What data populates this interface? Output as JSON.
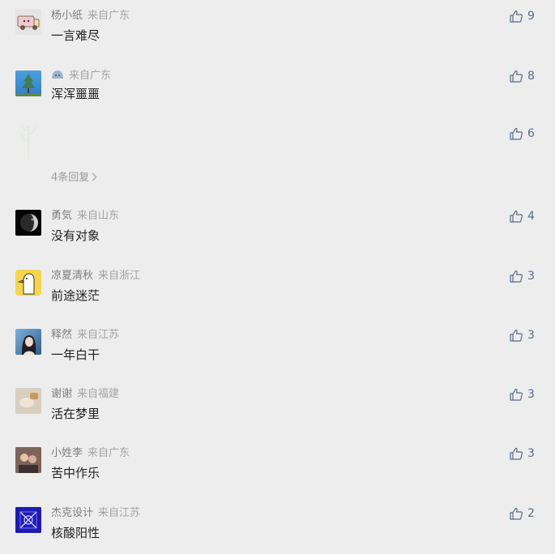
{
  "comments": [
    {
      "name": "杨小纸",
      "location": "来自广东",
      "text": "一言难尽",
      "likes": "9",
      "avatar": "truck-avatar"
    },
    {
      "name": "",
      "location": "来自广东",
      "text": "浑浑噩噩",
      "likes": "8",
      "avatar": "tree-avatar"
    },
    {
      "name": "",
      "location": "",
      "text": "",
      "likes": "6",
      "avatar": "plant-avatar",
      "replies": "4条回复"
    },
    {
      "name": "勇気",
      "location": "来自山东",
      "text": "没有对象",
      "likes": "4",
      "avatar": "moon-avatar"
    },
    {
      "name": "凉夏清秋",
      "location": "来自浙江",
      "text": "前途迷茫",
      "likes": "3",
      "avatar": "duck-avatar"
    },
    {
      "name": "释然",
      "location": "来自江苏",
      "text": "一年白干",
      "likes": "3",
      "avatar": "girl-avatar"
    },
    {
      "name": "谢谢",
      "location": "来自福建",
      "text": "活在梦里",
      "likes": "3",
      "avatar": "hand-avatar"
    },
    {
      "name": "小姓李",
      "location": "来自广东",
      "text": "苦中作乐",
      "likes": "3",
      "avatar": "couple-avatar"
    },
    {
      "name": "杰克设计",
      "location": "来自江苏",
      "text": "核酸阳性",
      "likes": "2",
      "avatar": "pattern-avatar"
    }
  ],
  "colors": {
    "background": "#ededed",
    "accent": "#5a6b8c"
  },
  "icons": {
    "like": "thumbs-up-icon",
    "chevron": "chevron-right-icon"
  }
}
